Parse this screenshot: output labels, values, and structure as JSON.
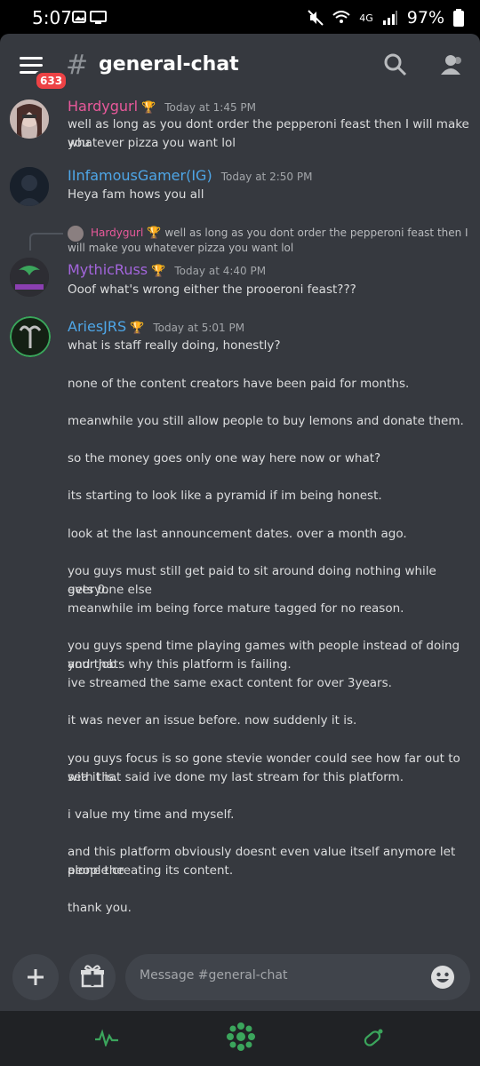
{
  "status_bar": {
    "time": "5:07",
    "network": "4G",
    "battery": "97%"
  },
  "header": {
    "channel_hash": "#",
    "channel_name": "general-chat",
    "unread_badge": "633"
  },
  "messages": [
    {
      "username": "Hardygurl",
      "name_color": "#e9599b",
      "timestamp": "Today at 1:45 PM",
      "lines": [
        "well as long as you dont order the pepperoni feast then I will make you",
        "whatever pizza you want lol"
      ]
    },
    {
      "username": "IInfamousGamer(IG)",
      "name_color": "#4ea6e7",
      "timestamp": "Today at 2:50 PM",
      "lines": [
        "Heya fam hows you all"
      ]
    },
    {
      "username": "MythicRuss",
      "name_color": "#a365dc",
      "timestamp": "Today at 4:40 PM",
      "reply": {
        "username": "Hardygurl",
        "text": "well as long as you dont order the pepperoni feast then I will make you whatever pizza you want lol"
      },
      "lines": [
        "Ooof what's wrong either the prooeroni feast???"
      ]
    },
    {
      "username": "AriesJRS",
      "name_color": "#4ea6e7",
      "timestamp": "Today at 5:01 PM",
      "lines": [
        "what is staff really doing, honestly?",
        "none of the content creators have been paid for months.",
        "meanwhile you still allow people to buy lemons and donate them.",
        "so the money goes only one way here now or what?",
        "its starting to look like a pyramid if im being honest.",
        "look at the last announcement dates. over a month ago.",
        "you guys must still get paid to sit around doing nothing while everyone else",
        "gets 0.",
        "meanwhile im being force mature tagged for no reason.",
        "you guys spend time playing games with people instead of doing your job",
        "and thats why this platform is failing.",
        "ive streamed the same exact content for over 3years.",
        "it was never an issue before. now suddenly it is.",
        "you guys focus is so gone stevie wonder could see how far out to sea it is.",
        "with that said ive done my last stream for this platform.",
        "i value my time and myself.",
        "and this platform obviously doesnt even value itself anymore let alone the",
        "people creating its content.",
        "thank you."
      ]
    }
  ],
  "composer": {
    "placeholder": "Message #general-chat"
  },
  "bottom_nav": [
    "activity-icon",
    "community-icon",
    "nitro-icon"
  ],
  "colors": {
    "background": "#36393f",
    "input": "#40444b",
    "accent_green": "#3ba55c"
  }
}
